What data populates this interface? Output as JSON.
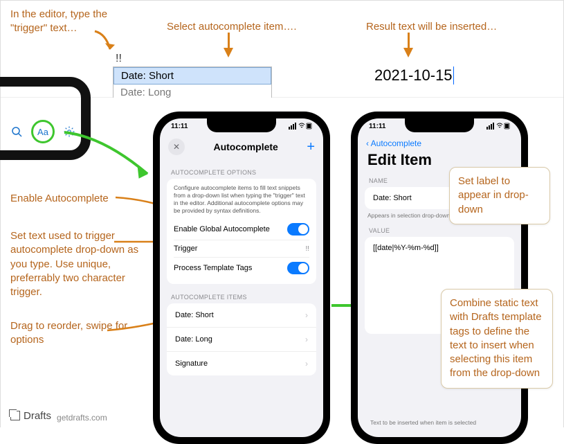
{
  "top": {
    "callout_trigger": "In the editor, type the \"trigger\" text…",
    "callout_select": "Select autocomplete item….",
    "callout_result": "Result text will be inserted…",
    "trigger_typed": "!!",
    "dropdown": [
      "Date: Short",
      "Date: Long"
    ],
    "result": "2021-10-15"
  },
  "toolbar": {
    "aa_label": "Aa"
  },
  "left_callouts": {
    "enable": "Enable Autocomplete",
    "trigger": "Set text used to trigger autocomplete drop-down as you type. Use unique, preferrably two character trigger.",
    "reorder": "Drag to reorder, swipe for options"
  },
  "phone1": {
    "time": "11:11",
    "title": "Autocomplete",
    "section_options": "AUTOCOMPLETE OPTIONS",
    "desc": "Configure autocomplete items to fill text snippets from a drop-down list when typing the \"trigger\" text in the editor. Additional autocomplete options may be provided by syntax definitions.",
    "row_enable": "Enable Global Autocomplete",
    "row_trigger": "Trigger",
    "trigger_value": "!!",
    "row_tags": "Process Template Tags",
    "section_items": "AUTOCOMPLETE ITEMS",
    "items": [
      "Date: Short",
      "Date: Long",
      "Signature"
    ]
  },
  "phone2": {
    "time": "11:11",
    "back": "Autocomplete",
    "title": "Edit Item",
    "name_hdr": "NAME",
    "name_value": "Date: Short",
    "name_hint": "Appears in selection drop-down",
    "value_hdr": "VALUE",
    "value_value": "[[date|%Y-%m-%d]]",
    "value_hint": "Text to be inserted when item is selected"
  },
  "bubbles": {
    "label": "Set label to appear in drop-down",
    "value": "Combine static text with Drafts template tags to define the text to insert when selecting this item from the drop-down"
  },
  "footer": {
    "brand": "Drafts",
    "url": "getdrafts.com"
  }
}
